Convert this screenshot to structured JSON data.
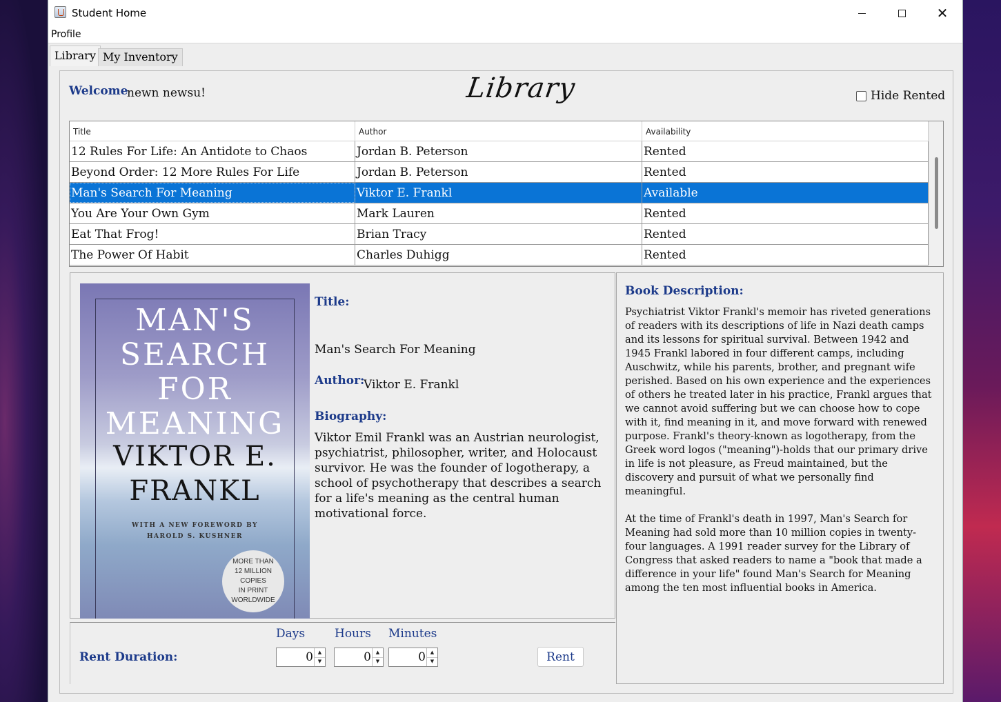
{
  "window": {
    "title": "Student Home"
  },
  "menu": {
    "profile": "Profile"
  },
  "tabs": [
    {
      "label": "Library"
    },
    {
      "label": "My Inventory"
    }
  ],
  "header": {
    "welcome_label": "Welcome",
    "user_name": "newn newsu!",
    "page_title": "Library",
    "hide_rented_label": "Hide Rented",
    "hide_rented_checked": false
  },
  "table": {
    "columns": [
      "Title",
      "Author",
      "Availability"
    ],
    "rows": [
      {
        "title": "12 Rules For Life: An Antidote to Chaos",
        "author": "Jordan B. Peterson",
        "availability": "Rented"
      },
      {
        "title": "Beyond Order: 12 More Rules For Life",
        "author": "Jordan B. Peterson",
        "availability": "Rented"
      },
      {
        "title": "Man's Search For Meaning",
        "author": "Viktor E. Frankl",
        "availability": "Available",
        "selected": true
      },
      {
        "title": "You Are Your Own Gym",
        "author": "Mark Lauren",
        "availability": "Rented"
      },
      {
        "title": "Eat That Frog!",
        "author": "Brian Tracy",
        "availability": "Rented"
      },
      {
        "title": "The Power Of Habit",
        "author": "Charles Duhigg",
        "availability": "Rented"
      }
    ]
  },
  "cover": {
    "title_lines": [
      "MAN'S",
      "SEARCH",
      "FOR",
      "MEANING"
    ],
    "author_lines": [
      "VIKTOR E.",
      "FRANKL"
    ],
    "foreword_lines": [
      "WITH A NEW FOREWORD BY",
      "HAROLD S. KUSHNER"
    ],
    "badge_lines": [
      "MORE THAN",
      "12 MILLION COPIES",
      "IN PRINT",
      "WORLDWIDE"
    ]
  },
  "details": {
    "title_label": "Title:",
    "title_value": "Man's Search For Meaning",
    "author_label": "Author:",
    "author_value": "Viktor E. Frankl",
    "biography_label": "Biography:",
    "biography": "Viktor Emil Frankl was an Austrian neurologist, psychiatrist, philosopher, writer, and Holocaust survivor. He was the founder of logotherapy, a school of psychotherapy that describes a search for a life's meaning as the central human motivational force."
  },
  "rent": {
    "label": "Rent Duration:",
    "days_label": "Days",
    "days_value": "0",
    "hours_label": "Hours",
    "hours_value": "0",
    "minutes_label": "Minutes",
    "minutes_value": "0",
    "button": "Rent"
  },
  "description": {
    "label": "Book Description:",
    "paragraph1": "Psychiatrist Viktor Frankl's memoir has riveted generations of readers with its descriptions of life in Nazi death camps and its lessons for spiritual survival. Between 1942 and 1945 Frankl labored in four different camps, including Auschwitz, while his parents, brother, and pregnant wife perished. Based on his own experience and the experiences of others he treated later in his practice, Frankl argues that we cannot avoid suffering but we can choose how to cope with it, find meaning in it, and move forward with renewed purpose. Frankl's theory-known as logotherapy, from the Greek word logos (\"meaning\")-holds that our primary drive in life is not pleasure, as Freud maintained, but the discovery and pursuit of what we personally find meaningful.",
    "paragraph2": "At the time of Frankl's death in 1997, Man's Search for Meaning had sold more than 10 million copies in twenty-four languages. A 1991 reader survey for the Library of Congress that asked readers to name a \"book that made a difference in your life\" found Man's Search for Meaning among the ten most influential books in America."
  },
  "colors": {
    "label_blue": "#1c3a8a",
    "selection": "#0a74d6"
  }
}
